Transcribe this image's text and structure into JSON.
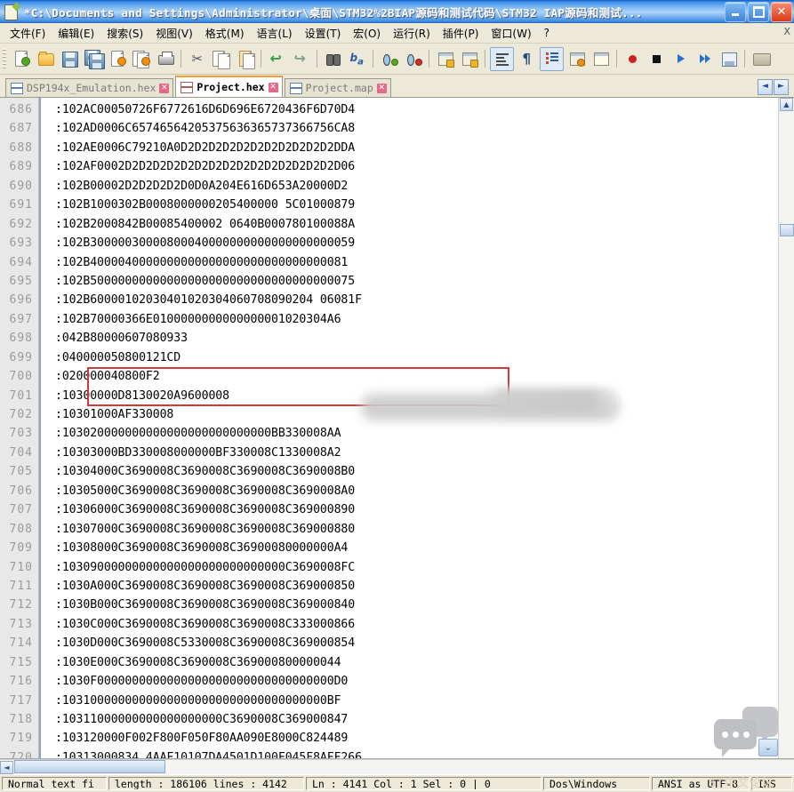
{
  "window": {
    "title": "*C:\\Documents and Settings\\Administrator\\桌面\\STM32%2BIAP源码和测试代码\\STM32  IAP源码和测试...",
    "icon": "notepad-plus-plus-icon",
    "minimize_label": "",
    "maximize_label": "",
    "close_label": "✕"
  },
  "menubar": {
    "items": [
      {
        "label": "文件(F)",
        "name": "menu-file"
      },
      {
        "label": "编辑(E)",
        "name": "menu-edit"
      },
      {
        "label": "搜索(S)",
        "name": "menu-search"
      },
      {
        "label": "视图(V)",
        "name": "menu-view"
      },
      {
        "label": "格式(M)",
        "name": "menu-format"
      },
      {
        "label": "语言(L)",
        "name": "menu-language"
      },
      {
        "label": "设置(T)",
        "name": "menu-settings"
      },
      {
        "label": "宏(O)",
        "name": "menu-macro"
      },
      {
        "label": "运行(R)",
        "name": "menu-run"
      },
      {
        "label": "插件(P)",
        "name": "menu-plugins"
      },
      {
        "label": "窗口(W)",
        "name": "menu-window"
      },
      {
        "label": "?",
        "name": "menu-help"
      }
    ],
    "right_marker": "X"
  },
  "toolbar": {
    "buttons": [
      "new-file-icon",
      "open-file-icon",
      "save-icon",
      "save-all-icon",
      "close-file-icon",
      "close-all-icon",
      "print-icon",
      "cut-icon",
      "copy-icon",
      "paste-icon",
      "undo-icon",
      "redo-icon",
      "find-icon",
      "replace-icon",
      "zoom-in-icon",
      "zoom-out-icon",
      "sync-vertical-scroll-icon",
      "sync-horizontal-scroll-icon",
      "word-wrap-icon",
      "show-all-characters-icon",
      "indent-guide-icon",
      "user-defined-dialog-icon",
      "document-map-icon",
      "record-macro-icon",
      "stop-recording-icon",
      "play-macro-icon",
      "run-macro-multiple-icon",
      "save-macro-icon",
      "run-icon"
    ]
  },
  "tabs": [
    {
      "label": "DSP194x_Emulation.hex",
      "active": false,
      "close": "✕",
      "name": "tab-dsp194x-emulation-hex"
    },
    {
      "label": "Project.hex",
      "active": true,
      "close": "✕",
      "name": "tab-project-hex"
    },
    {
      "label": "Project.map",
      "active": false,
      "close": "✕",
      "name": "tab-project-map"
    }
  ],
  "tab_nav": {
    "prev": "◄",
    "next": "►"
  },
  "editor": {
    "first_line_number": 686,
    "lines": [
      {
        "n": "686",
        "text": ":102AC00050726F6772616D6D696E6720436F6D70D4"
      },
      {
        "n": "687",
        "text": ":102AD0006C65746564205375636365737366756CA8"
      },
      {
        "n": "688",
        "text": ":102AE0006C79210A0D2D2D2D2D2D2D2D2D2D2D2DDA"
      },
      {
        "n": "689",
        "text": ":102AF0002D2D2D2D2D2D2D2D2D2D2D2D2D2D2D2D06"
      },
      {
        "n": "690",
        "text": ":102B00002D2D2D2D2D0D0A204E616D653A20000D2"
      },
      {
        "n": "691",
        "text": ":102B1000302B0008000000205400000 5C01000879"
      },
      {
        "n": "692",
        "text": ":102B2000842B00085400002 0640B000780100088A"
      },
      {
        "n": "693",
        "text": ":102B30000030000800040000000000000000000059"
      },
      {
        "n": "694",
        "text": ":102B4000040000000000000000000000000000081"
      },
      {
        "n": "695",
        "text": ":102B50000000000000000000000000000000000075"
      },
      {
        "n": "696",
        "text": ":102B60000102030401020304060708090204 06081F"
      },
      {
        "n": "697",
        "text": ":102B70000366E0100000000000000001020304A6"
      },
      {
        "n": "698",
        "text": ":042B80000607080933"
      },
      {
        "n": "699",
        "text": ":040000050800121CD"
      },
      {
        "n": "700",
        "text": ":020000040800F2"
      },
      {
        "n": "701",
        "text": ":10300000D8130020A9600008"
      },
      {
        "n": "702",
        "text": ":10301000AF330008"
      },
      {
        "n": "703",
        "text": ":103020000000000000000000000000BB330008AA"
      },
      {
        "n": "704",
        "text": ":10303000BD330008000000BF330008C1330008A2"
      },
      {
        "n": "705",
        "text": ":10304000C3690008C3690008C3690008C3690008B0"
      },
      {
        "n": "706",
        "text": ":10305000C3690008C3690008C3690008C3690008A0"
      },
      {
        "n": "707",
        "text": ":10306000C3690008C3690008C3690008C369000890"
      },
      {
        "n": "708",
        "text": ":10307000C3690008C3690008C3690008C369000880"
      },
      {
        "n": "709",
        "text": ":10308000C3690008C3690008C36900080000000A4"
      },
      {
        "n": "710",
        "text": ":10309000000000000000000000000000C3690008FC"
      },
      {
        "n": "711",
        "text": ":1030A000C3690008C3690008C3690008C369000850"
      },
      {
        "n": "712",
        "text": ":1030B000C3690008C3690008C3690008C369000840"
      },
      {
        "n": "713",
        "text": ":1030C000C3690008C3690008C3690008C333000866"
      },
      {
        "n": "714",
        "text": ":1030D000C3690008C5330008C3690008C369000854"
      },
      {
        "n": "715",
        "text": ":1030E000C3690008C3690008C369000800000044"
      },
      {
        "n": "716",
        "text": ":1030F0000000000000000000000000000000000D0"
      },
      {
        "n": "717",
        "text": ":10310000000000000000000000000000000000BF"
      },
      {
        "n": "718",
        "text": ":10311000000000000000000C3690008C369000847"
      },
      {
        "n": "719",
        "text": ":103120000F002F800F050F80AA090E8000C824489"
      },
      {
        "n": "720",
        "text": ":10313000834 4AAF10107DA4501D100F045F8AFF266"
      }
    ],
    "annotation": {
      "type": "red-rectangle",
      "covers_lines": [
        "700",
        "701"
      ]
    },
    "redaction": {
      "type": "blur",
      "covers_lines": [
        "701",
        "702"
      ]
    }
  },
  "statusbar": {
    "doc_type": "Normal text fi",
    "length_lines": "length : 186106        lines : 4142",
    "caret": "Ln : 4141        Col : 1        Sel : 0 | 0",
    "eol": "Dos\\Windows",
    "encoding": "ANSI as UTF-8",
    "insert_mode": "INS"
  },
  "watermark": {
    "text": "ST中文论坛",
    "icon": "chat-bubbles-icon",
    "chevron": "⌄"
  }
}
